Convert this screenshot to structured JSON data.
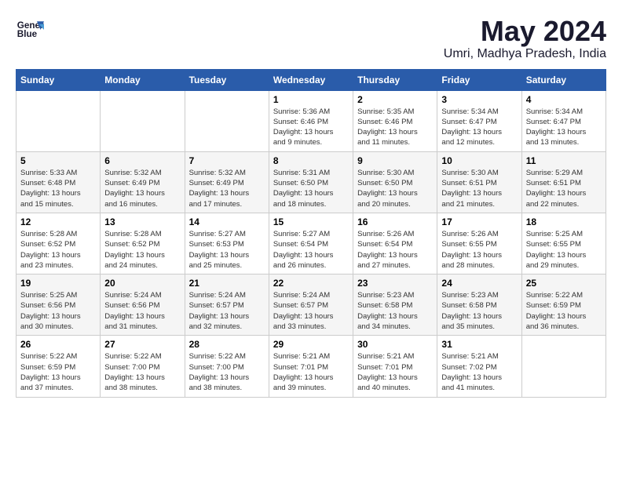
{
  "header": {
    "logo_line1": "General",
    "logo_line2": "Blue",
    "title": "May 2024",
    "subtitle": "Umri, Madhya Pradesh, India"
  },
  "calendar": {
    "days_of_week": [
      "Sunday",
      "Monday",
      "Tuesday",
      "Wednesday",
      "Thursday",
      "Friday",
      "Saturday"
    ],
    "weeks": [
      [
        {
          "day": "",
          "info": ""
        },
        {
          "day": "",
          "info": ""
        },
        {
          "day": "",
          "info": ""
        },
        {
          "day": "1",
          "info": "Sunrise: 5:36 AM\nSunset: 6:46 PM\nDaylight: 13 hours\nand 9 minutes."
        },
        {
          "day": "2",
          "info": "Sunrise: 5:35 AM\nSunset: 6:46 PM\nDaylight: 13 hours\nand 11 minutes."
        },
        {
          "day": "3",
          "info": "Sunrise: 5:34 AM\nSunset: 6:47 PM\nDaylight: 13 hours\nand 12 minutes."
        },
        {
          "day": "4",
          "info": "Sunrise: 5:34 AM\nSunset: 6:47 PM\nDaylight: 13 hours\nand 13 minutes."
        }
      ],
      [
        {
          "day": "5",
          "info": "Sunrise: 5:33 AM\nSunset: 6:48 PM\nDaylight: 13 hours\nand 15 minutes."
        },
        {
          "day": "6",
          "info": "Sunrise: 5:32 AM\nSunset: 6:49 PM\nDaylight: 13 hours\nand 16 minutes."
        },
        {
          "day": "7",
          "info": "Sunrise: 5:32 AM\nSunset: 6:49 PM\nDaylight: 13 hours\nand 17 minutes."
        },
        {
          "day": "8",
          "info": "Sunrise: 5:31 AM\nSunset: 6:50 PM\nDaylight: 13 hours\nand 18 minutes."
        },
        {
          "day": "9",
          "info": "Sunrise: 5:30 AM\nSunset: 6:50 PM\nDaylight: 13 hours\nand 20 minutes."
        },
        {
          "day": "10",
          "info": "Sunrise: 5:30 AM\nSunset: 6:51 PM\nDaylight: 13 hours\nand 21 minutes."
        },
        {
          "day": "11",
          "info": "Sunrise: 5:29 AM\nSunset: 6:51 PM\nDaylight: 13 hours\nand 22 minutes."
        }
      ],
      [
        {
          "day": "12",
          "info": "Sunrise: 5:28 AM\nSunset: 6:52 PM\nDaylight: 13 hours\nand 23 minutes."
        },
        {
          "day": "13",
          "info": "Sunrise: 5:28 AM\nSunset: 6:52 PM\nDaylight: 13 hours\nand 24 minutes."
        },
        {
          "day": "14",
          "info": "Sunrise: 5:27 AM\nSunset: 6:53 PM\nDaylight: 13 hours\nand 25 minutes."
        },
        {
          "day": "15",
          "info": "Sunrise: 5:27 AM\nSunset: 6:54 PM\nDaylight: 13 hours\nand 26 minutes."
        },
        {
          "day": "16",
          "info": "Sunrise: 5:26 AM\nSunset: 6:54 PM\nDaylight: 13 hours\nand 27 minutes."
        },
        {
          "day": "17",
          "info": "Sunrise: 5:26 AM\nSunset: 6:55 PM\nDaylight: 13 hours\nand 28 minutes."
        },
        {
          "day": "18",
          "info": "Sunrise: 5:25 AM\nSunset: 6:55 PM\nDaylight: 13 hours\nand 29 minutes."
        }
      ],
      [
        {
          "day": "19",
          "info": "Sunrise: 5:25 AM\nSunset: 6:56 PM\nDaylight: 13 hours\nand 30 minutes."
        },
        {
          "day": "20",
          "info": "Sunrise: 5:24 AM\nSunset: 6:56 PM\nDaylight: 13 hours\nand 31 minutes."
        },
        {
          "day": "21",
          "info": "Sunrise: 5:24 AM\nSunset: 6:57 PM\nDaylight: 13 hours\nand 32 minutes."
        },
        {
          "day": "22",
          "info": "Sunrise: 5:24 AM\nSunset: 6:57 PM\nDaylight: 13 hours\nand 33 minutes."
        },
        {
          "day": "23",
          "info": "Sunrise: 5:23 AM\nSunset: 6:58 PM\nDaylight: 13 hours\nand 34 minutes."
        },
        {
          "day": "24",
          "info": "Sunrise: 5:23 AM\nSunset: 6:58 PM\nDaylight: 13 hours\nand 35 minutes."
        },
        {
          "day": "25",
          "info": "Sunrise: 5:22 AM\nSunset: 6:59 PM\nDaylight: 13 hours\nand 36 minutes."
        }
      ],
      [
        {
          "day": "26",
          "info": "Sunrise: 5:22 AM\nSunset: 6:59 PM\nDaylight: 13 hours\nand 37 minutes."
        },
        {
          "day": "27",
          "info": "Sunrise: 5:22 AM\nSunset: 7:00 PM\nDaylight: 13 hours\nand 38 minutes."
        },
        {
          "day": "28",
          "info": "Sunrise: 5:22 AM\nSunset: 7:00 PM\nDaylight: 13 hours\nand 38 minutes."
        },
        {
          "day": "29",
          "info": "Sunrise: 5:21 AM\nSunset: 7:01 PM\nDaylight: 13 hours\nand 39 minutes."
        },
        {
          "day": "30",
          "info": "Sunrise: 5:21 AM\nSunset: 7:01 PM\nDaylight: 13 hours\nand 40 minutes."
        },
        {
          "day": "31",
          "info": "Sunrise: 5:21 AM\nSunset: 7:02 PM\nDaylight: 13 hours\nand 41 minutes."
        },
        {
          "day": "",
          "info": ""
        }
      ]
    ]
  }
}
